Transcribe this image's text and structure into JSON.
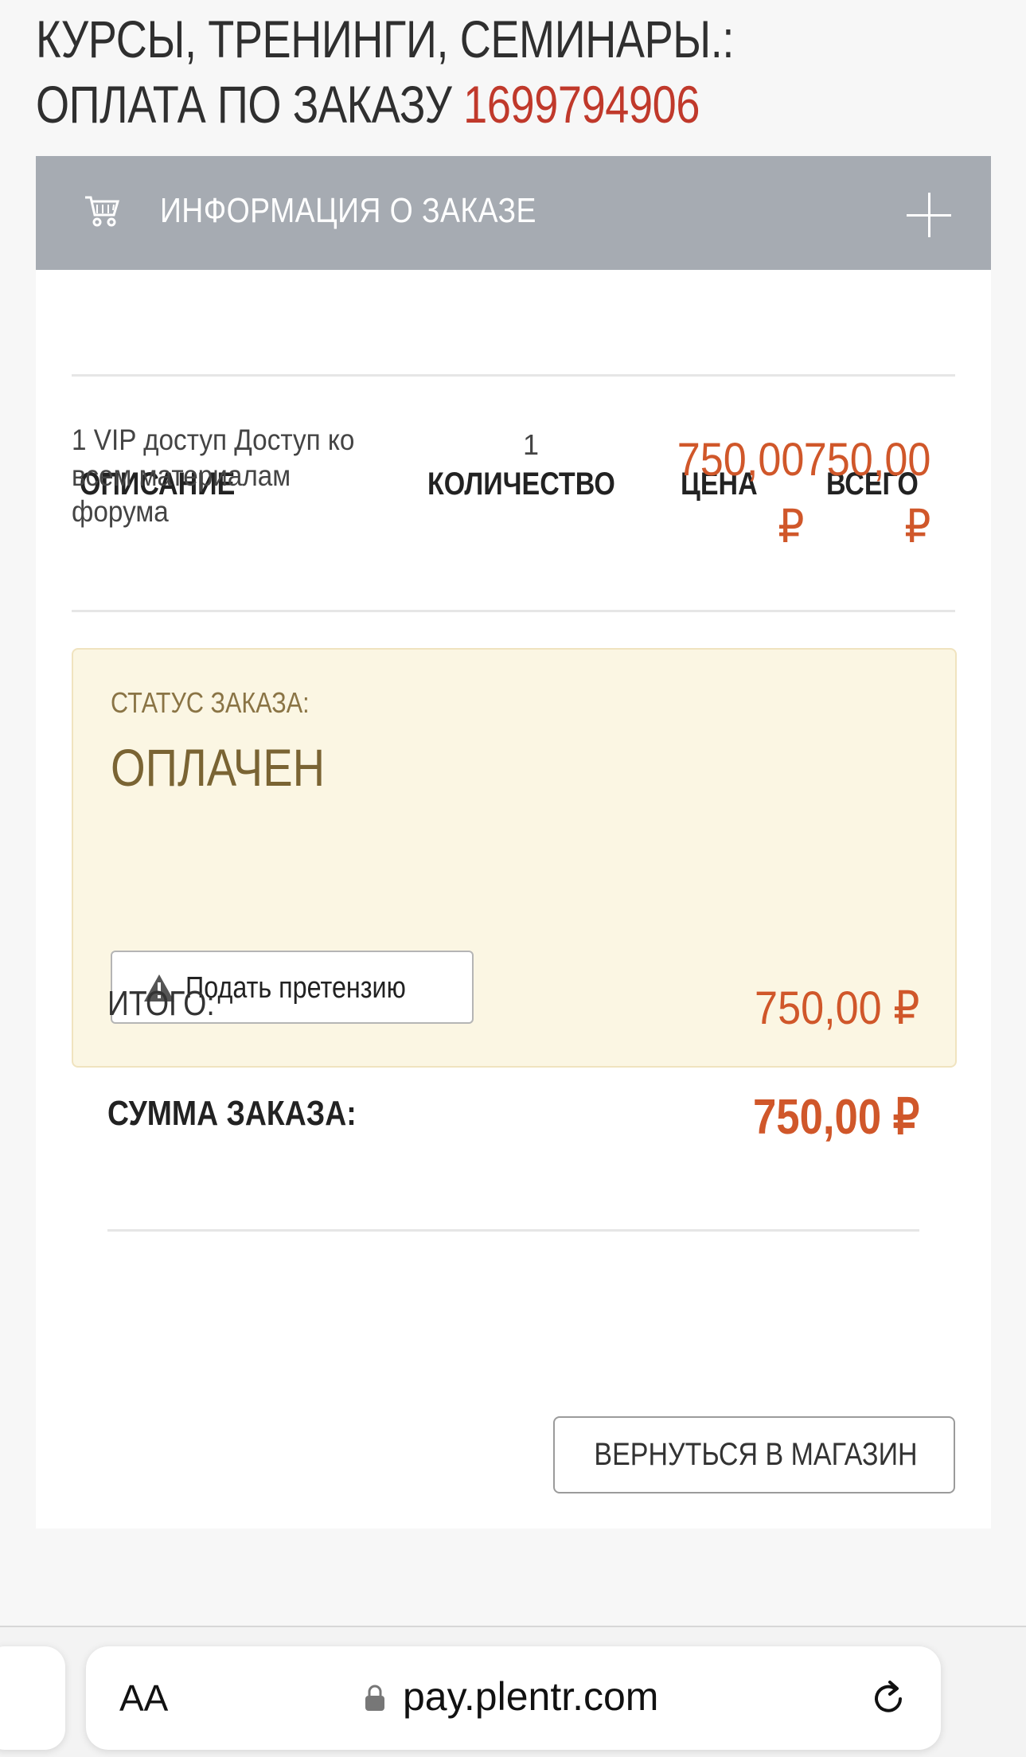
{
  "page": {
    "title": "Курсы, тренинги, семинары.: оплата по заказу",
    "order_number": "1699794906"
  },
  "panel": {
    "title": "ИНФОРМАЦИЯ О ЗАКАЗЕ",
    "icon": "cart-icon",
    "toggle_icon": "plus-icon"
  },
  "table": {
    "headers": [
      "ОПИСАНИЕ",
      "КОЛИЧЕСТВО",
      "ЦЕНА",
      "ВСЕГО"
    ],
    "rows": [
      {
        "description": "1 VIP доступ Доступ ко всем материалам форума",
        "quantity": "1",
        "price": "750,00",
        "total": "750,00",
        "currency": "₽"
      }
    ]
  },
  "status": {
    "label": "СТАТУС ЗАКАЗА:",
    "value": "ОПЛАЧЕН",
    "claim_button": "Подать претензию",
    "claim_icon": "warning-icon"
  },
  "summary": {
    "subtotal_label": "ИТОГО:",
    "subtotal_value": "750,00 ₽",
    "order_sum_label": "СУММА ЗАКАЗА:",
    "order_sum_value": "750,00 ₽"
  },
  "actions": {
    "back_to_shop": "ВЕРНУТЬСЯ В МАГАЗИН"
  },
  "browser": {
    "text_size_button": "AA",
    "url": "pay.plentr.com"
  },
  "colors": {
    "accent": "#d0572a",
    "order_number": "#c0392b",
    "panel_header": "#a6abb2",
    "status_bg": "#fbf6e3"
  }
}
